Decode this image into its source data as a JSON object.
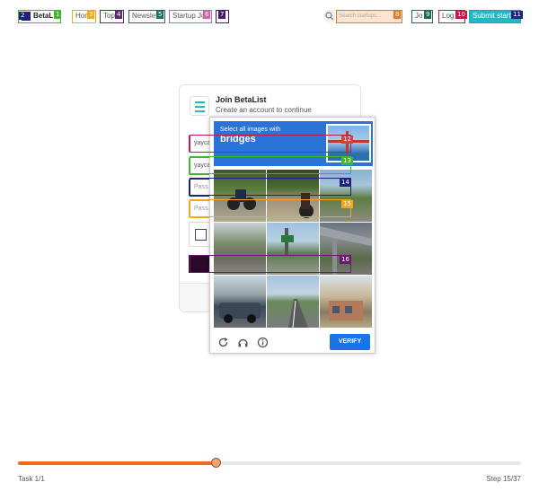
{
  "nav": {
    "logo_text": "BetaL",
    "home_label": "Hon",
    "topics_label": "Top",
    "newsletter_label": "Newslet",
    "startup_jobs_label": "Startup Jo",
    "search_placeholder": "Search startups...",
    "join_label": "Jo",
    "login_label": "Log",
    "submit_label": "Submit startu"
  },
  "som_markers": [
    "2",
    "1",
    "3",
    "4",
    "5",
    "6",
    "7",
    "8",
    "9",
    "10",
    "11",
    "12",
    "13",
    "14",
    "15",
    "16"
  ],
  "card": {
    "title": "Join BetaList",
    "subtitle": "Create an account to continue",
    "field1_value": "yayca",
    "field2_value": "yayca",
    "field3_placeholder": "Pass",
    "field4_placeholder": "Pass"
  },
  "captcha": {
    "instruction": "Select all images with",
    "target": "bridges",
    "verify_label": "VERIFY",
    "icons": [
      "reload-icon",
      "audio-icon",
      "info-icon"
    ],
    "accent": "#2a73d9"
  },
  "progress": {
    "fraction": 0.393,
    "task_label": "Task 1/1",
    "step_label": "Step 15/37",
    "fill_color": "#f26a1b"
  }
}
